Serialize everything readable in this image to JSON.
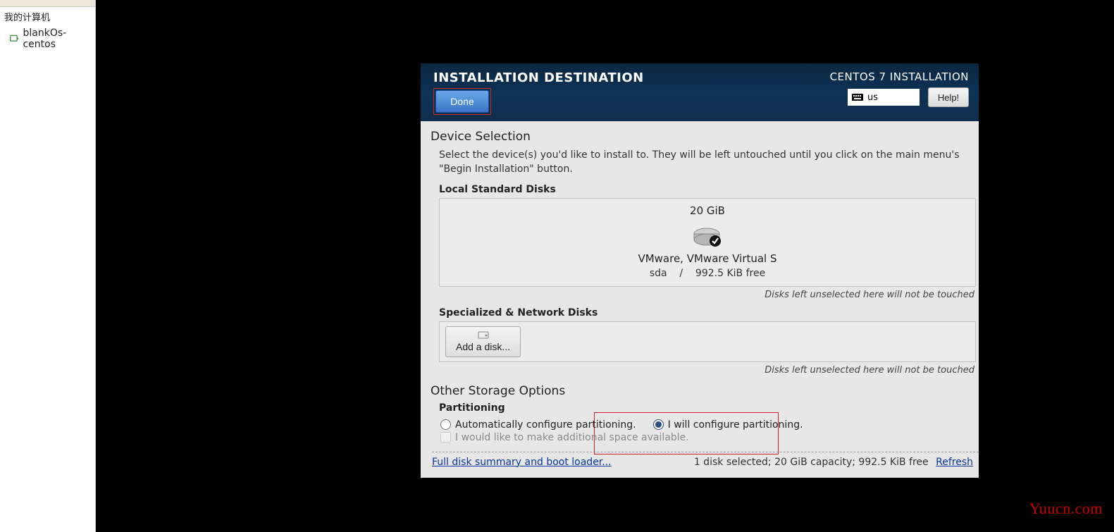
{
  "sidebar": {
    "title": "我的计算机",
    "item_label": "blankOs-centos"
  },
  "header": {
    "title": "INSTALLATION DESTINATION",
    "done_label": "Done",
    "product_title": "CENTOS 7 INSTALLATION",
    "keyboard_layout": "us",
    "help_label": "Help!"
  },
  "device_selection": {
    "title": "Device Selection",
    "description": "Select the device(s) you'd like to install to.  They will be left untouched until you click on the main menu's \"Begin Installation\" button.",
    "local_disks_label": "Local Standard Disks",
    "disk": {
      "size": "20 GiB",
      "name": "VMware, VMware Virtual S",
      "device": "sda",
      "sep": "/",
      "free": "992.5 KiB free"
    },
    "hint": "Disks left unselected here will not be touched",
    "specialized_label": "Specialized & Network Disks",
    "add_disk_label": "Add a disk..."
  },
  "other_storage": {
    "title": "Other Storage Options",
    "partitioning_label": "Partitioning",
    "auto_label": "Automatically configure partitioning.",
    "manual_label": "I will configure partitioning.",
    "additional_space_label": "I would like to make additional space available."
  },
  "footer": {
    "summary_link": "Full disk summary and boot loader...",
    "status": "1 disk selected; 20 GiB capacity; 992.5 KiB free",
    "refresh_label": "Refresh"
  },
  "watermark": "Yuucn.com"
}
